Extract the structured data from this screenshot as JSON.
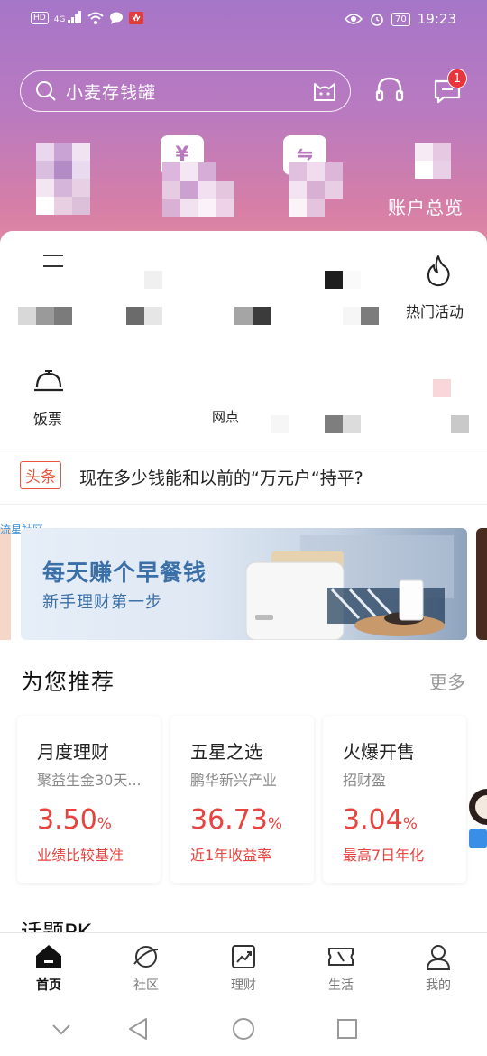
{
  "status_bar": {
    "hd": "HD",
    "network": "4G",
    "battery": "70",
    "time": "19:23"
  },
  "header": {
    "search_placeholder": "小麦存钱罐",
    "message_badge": "1",
    "yen_icon": "¥",
    "transfer_icon": "⇋",
    "account_overview": "账户总览"
  },
  "quick_grid": {
    "hot_activity": "热门活动",
    "meal_ticket": "饭票",
    "partial_label": "网点"
  },
  "headline": {
    "tag": "头条",
    "text": "现在多少钱能和以前的“万元户“持平?"
  },
  "banner": {
    "corner_label": "流星社区",
    "title": "每天赚个早餐钱",
    "subtitle": "新手理财第一步"
  },
  "recommend": {
    "title": "为您推荐",
    "more": "更多",
    "cards": [
      {
        "title": "月度理财",
        "subtitle": "聚益生金30天...",
        "value": "3.50",
        "unit": "%",
        "note": "业绩比较基准"
      },
      {
        "title": "五星之选",
        "subtitle": "鹏华新兴产业",
        "value": "36.73",
        "unit": "%",
        "note": "近1年收益率"
      },
      {
        "title": "火爆开售",
        "subtitle": "招财盈",
        "value": "3.04",
        "unit": "%",
        "note": "最高7日年化"
      }
    ]
  },
  "topic_pk": "话题PK",
  "tabs": [
    {
      "label": "首页",
      "icon": "home-icon",
      "active": true
    },
    {
      "label": "社区",
      "icon": "planet-icon",
      "active": false
    },
    {
      "label": "理财",
      "icon": "chart-up-icon",
      "active": false
    },
    {
      "label": "生活",
      "icon": "ticket-icon",
      "active": false
    },
    {
      "label": "我的",
      "icon": "person-icon",
      "active": false
    }
  ],
  "colors": {
    "accent_red": "#e8433f",
    "header_top": "#a676c8",
    "header_bottom": "#e08aa1",
    "banner_text": "#3b6fa8"
  }
}
